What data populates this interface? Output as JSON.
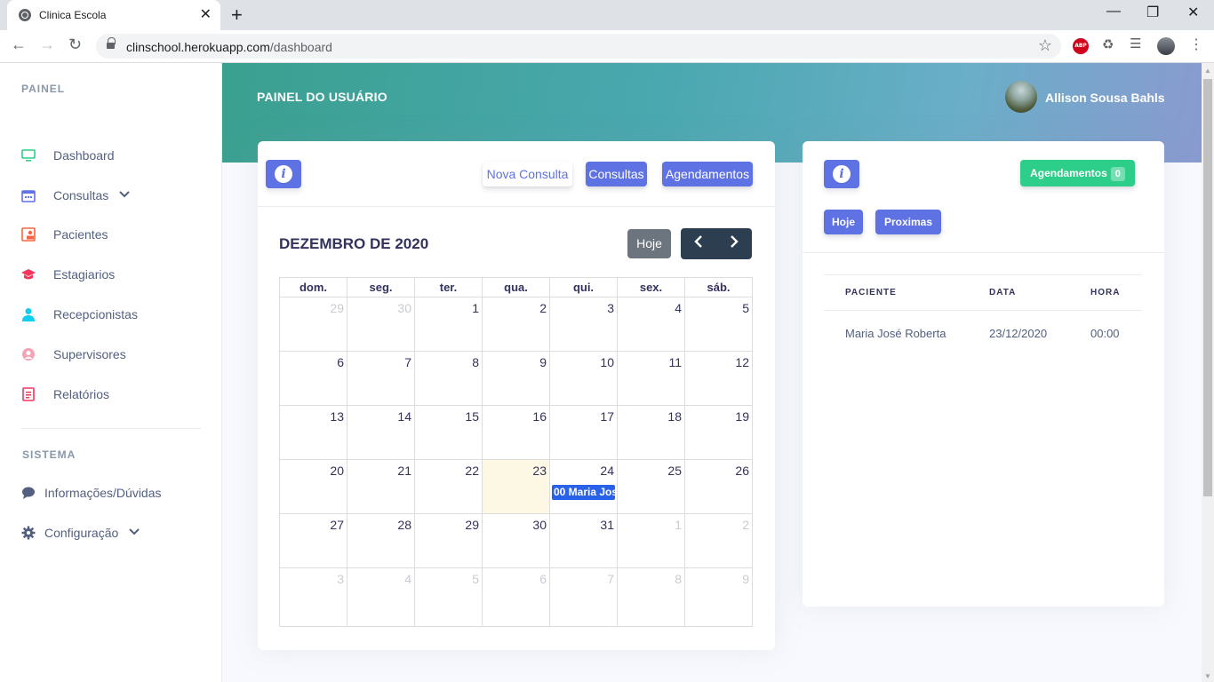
{
  "browser": {
    "tab_title": "Clinica Escola",
    "url_domain": "clinschool.herokuapp.com",
    "url_path": "/dashboard"
  },
  "sidebar": {
    "heading_painel": "PAINEL",
    "heading_sistema": "SISTEMA",
    "items": [
      {
        "label": "Dashboard",
        "icon": "monitor-icon"
      },
      {
        "label": "Consultas",
        "icon": "calendar-icon"
      },
      {
        "label": "Pacientes",
        "icon": "patient-icon"
      },
      {
        "label": "Estagiarios",
        "icon": "graduation-cap-icon"
      },
      {
        "label": "Recepcionistas",
        "icon": "user-icon"
      },
      {
        "label": "Supervisores",
        "icon": "user-circle-icon"
      },
      {
        "label": "Relatórios",
        "icon": "report-icon"
      }
    ],
    "system_items": [
      {
        "label": "Informações/Dúvidas",
        "icon": "chat-icon"
      },
      {
        "label": "Configuração",
        "icon": "gear-icon"
      }
    ]
  },
  "header": {
    "title": "PAINEL DO USUÁRIO",
    "user_name": "Allison Sousa Bahls"
  },
  "calendar": {
    "buttons": {
      "nova_consulta": "Nova Consulta",
      "consultas": "Consultas",
      "agendamentos": "Agendamentos"
    },
    "title": "DEZEMBRO DE 2020",
    "today_label": "Hoje",
    "weekdays": [
      "dom.",
      "seg.",
      "ter.",
      "qua.",
      "qui.",
      "sex.",
      "sáb."
    ],
    "weeks": [
      [
        "29",
        "30",
        "1",
        "2",
        "3",
        "4",
        "5"
      ],
      [
        "6",
        "7",
        "8",
        "9",
        "10",
        "11",
        "12"
      ],
      [
        "13",
        "14",
        "15",
        "16",
        "17",
        "18",
        "19"
      ],
      [
        "20",
        "21",
        "22",
        "23",
        "24",
        "25",
        "26"
      ],
      [
        "27",
        "28",
        "29",
        "30",
        "31",
        "1",
        "2"
      ],
      [
        "3",
        "4",
        "5",
        "6",
        "7",
        "8",
        "9"
      ]
    ],
    "event_label": "00 Maria Jos"
  },
  "agenda": {
    "badge_label": "Agendamentos",
    "badge_count": "0",
    "filter_hoje": "Hoje",
    "filter_proximas": "Proximas",
    "columns": [
      "PACIENTE",
      "DATA",
      "HORA"
    ],
    "rows": [
      {
        "paciente": "Maria José Roberta",
        "data": "23/12/2020",
        "hora": "00:00"
      }
    ]
  }
}
